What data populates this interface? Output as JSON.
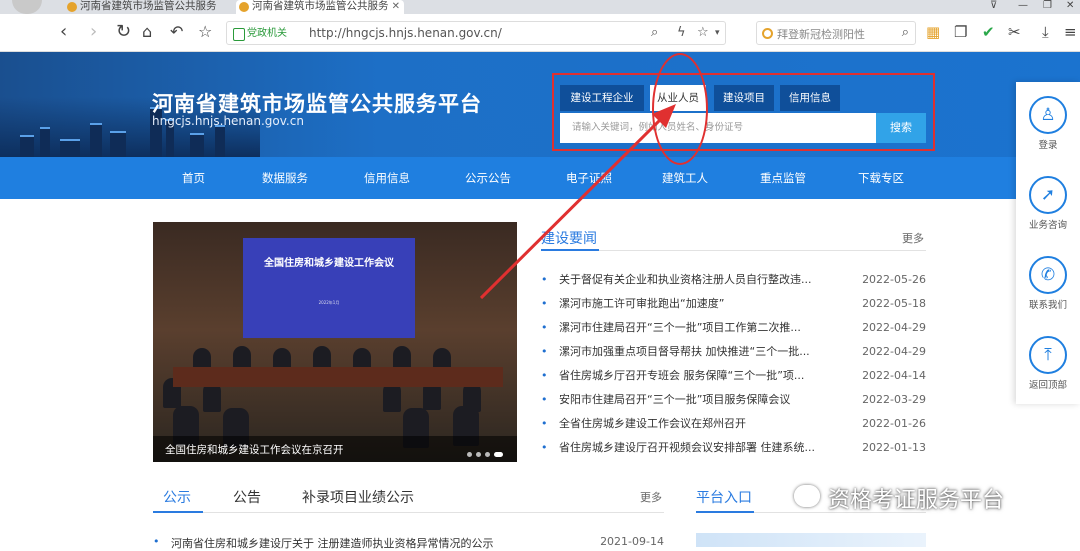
{
  "browser": {
    "tabs": [
      {
        "title": "河南省建筑市场监管公共服务"
      },
      {
        "title": "河南省建筑市场监管公共服务"
      }
    ],
    "address": {
      "cert_label": "党政机关",
      "url": "http://hngcjs.hnjs.henan.gov.cn/"
    },
    "search": {
      "text": "拜登新冠检测阳性"
    },
    "window_controls": [
      "⊽",
      "—",
      "❐",
      "✕"
    ]
  },
  "site": {
    "title": "河南省建筑市场监管公共服务平台",
    "domain": "hngcjs.hnjs.henan.gov.cn",
    "search_tabs": [
      "建设工程企业",
      "从业人员",
      "建设项目",
      "信用信息"
    ],
    "active_search_tab": 1,
    "search_placeholder": "请输入关键词，例如人员姓名、身份证号",
    "search_button": "搜索"
  },
  "nav": [
    "首页",
    "数据服务",
    "信用信息",
    "公示公告",
    "电子证照",
    "建筑工人",
    "重点监管",
    "下载专区"
  ],
  "carousel": {
    "screen_title": "全国住房和城乡建设工作会议",
    "screen_date": "2022年1月",
    "caption": "全国住房和城乡建设工作会议在京召开",
    "slides": 4,
    "active": 3
  },
  "news": {
    "heading": "建设要闻",
    "more": "更多",
    "items": [
      {
        "title": "关于督促有关企业和执业资格注册人员自行整改违...",
        "date": "2022-05-26"
      },
      {
        "title": "漯河市施工许可审批跑出“加速度”",
        "date": "2022-05-18"
      },
      {
        "title": "漯河市住建局召开“三个一批”项目工作第二次推...",
        "date": "2022-04-29"
      },
      {
        "title": "漯河市加强重点项目督导帮扶 加快推进“三个一批...",
        "date": "2022-04-29"
      },
      {
        "title": "省住房城乡厅召开专班会 服务保障“三个一批”项...",
        "date": "2022-04-14"
      },
      {
        "title": "安阳市住建局召开“三个一批”项目服务保障会议",
        "date": "2022-03-29"
      },
      {
        "title": "全省住房城乡建设工作会议在郑州召开",
        "date": "2022-01-26"
      },
      {
        "title": "省住房城乡建设厅召开视频会议安排部署 住建系统...",
        "date": "2022-01-13"
      }
    ]
  },
  "lower": {
    "tabs": [
      "公示",
      "公告",
      "补录项目业绩公示"
    ],
    "more": "更多",
    "item": {
      "title": "河南省住房和城乡建设厅关于 注册建造师执业资格异常情况的公示",
      "date": "2021-09-14"
    },
    "platform_heading": "平台入口"
  },
  "side": [
    {
      "label": "登录",
      "icon": "user-icon",
      "glyph": "♙"
    },
    {
      "label": "业务咨询",
      "icon": "compass-icon",
      "glyph": "➚"
    },
    {
      "label": "联系我们",
      "icon": "phone-icon",
      "glyph": "✆"
    },
    {
      "label": "返回顶部",
      "icon": "back-to-top-icon",
      "glyph": "⤒"
    }
  ],
  "watermark": "资格考证服务平台",
  "colors": {
    "accent": "#1f7fe0",
    "annotation": "#e03030",
    "search_button": "#31a3e8"
  }
}
